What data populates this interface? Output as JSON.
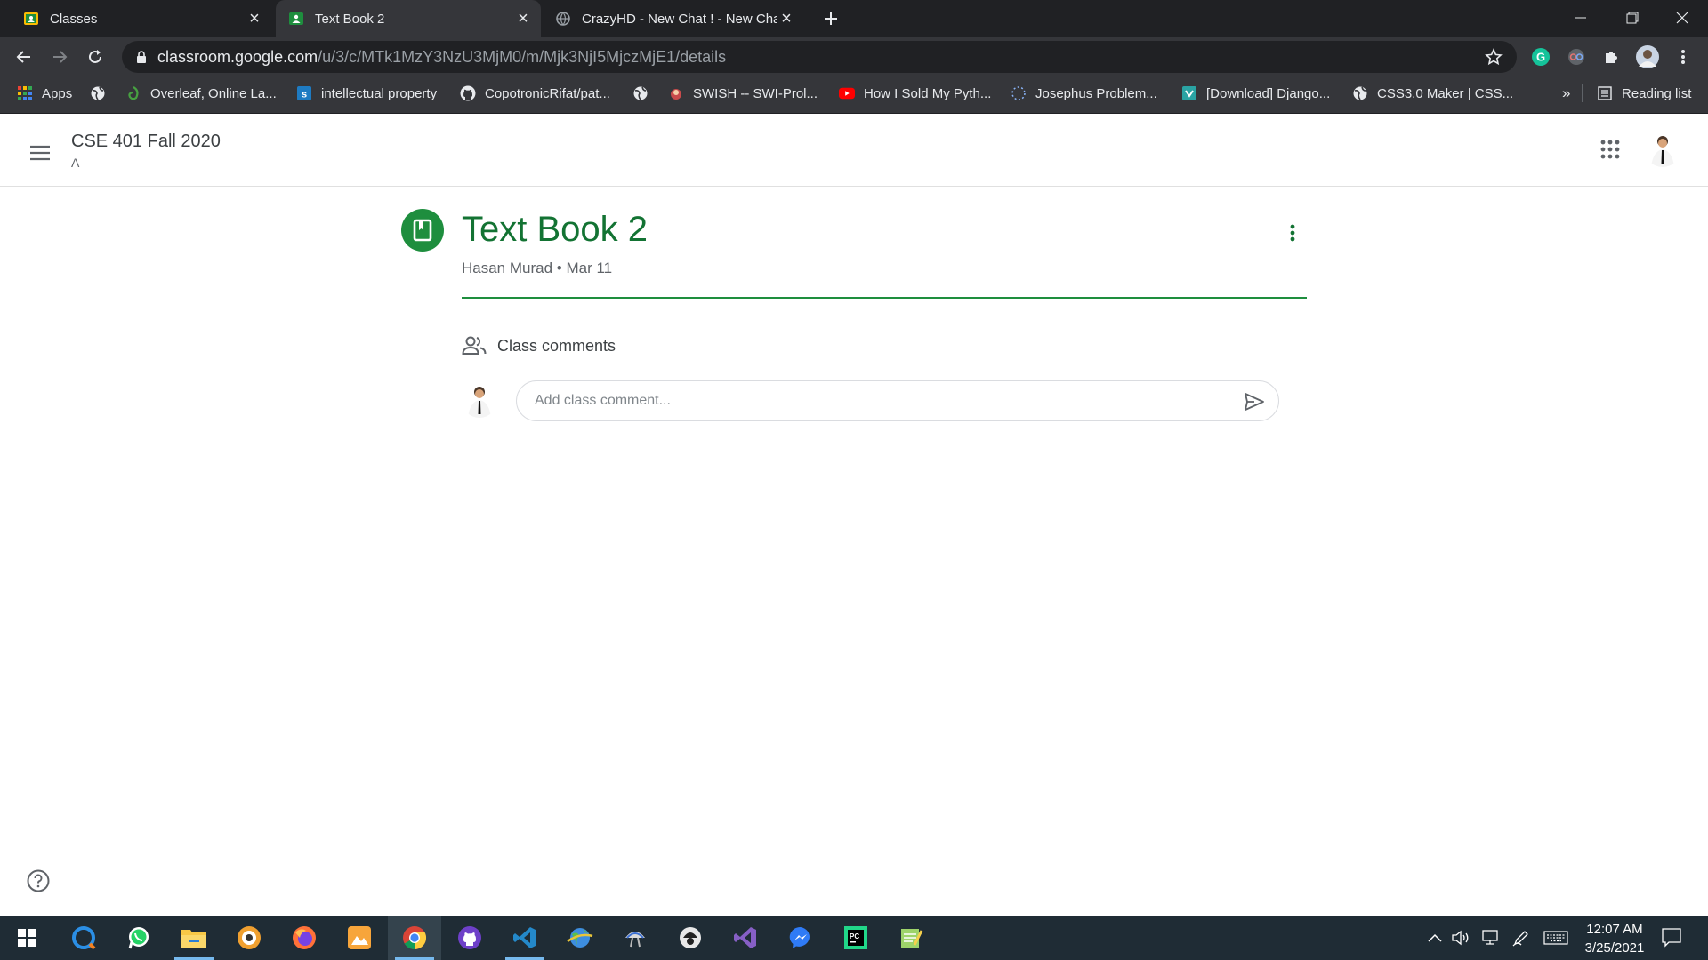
{
  "browser": {
    "tabs": [
      {
        "title": "Classes",
        "icon": "classroom-icon",
        "active": false
      },
      {
        "title": "Text Book 2",
        "icon": "classroom-icon",
        "active": true
      },
      {
        "title": "CrazyHD - New Chat ! - New Cha",
        "icon": "globe-icon",
        "active": false
      }
    ],
    "url_host": "classroom.google.com",
    "url_path": "/u/3/c/MTk1MzY3NzU3MjM0/m/Mjk3NjI5MjczMjE1/details",
    "bookmarks": [
      {
        "label": "Apps",
        "icon": "apps-grid-icon"
      },
      {
        "label": "",
        "icon": "globe-icon"
      },
      {
        "label": "Overleaf, Online La...",
        "icon": "overleaf-icon"
      },
      {
        "label": "intellectual property",
        "icon": "scribd-icon"
      },
      {
        "label": "CopotronicRifat/pat...",
        "icon": "github-icon"
      },
      {
        "label": "",
        "icon": "globe-icon"
      },
      {
        "label": "SWISH -- SWI-Prol...",
        "icon": "swish-icon"
      },
      {
        "label": "How I Sold My Pyth...",
        "icon": "youtube-icon"
      },
      {
        "label": "Josephus Problem...",
        "icon": "loading-icon"
      },
      {
        "label": "[Download] Django...",
        "icon": "site-icon"
      },
      {
        "label": "CSS3.0 Maker | CSS...",
        "icon": "globe-icon"
      }
    ],
    "bookmarks_overflow": "»",
    "reading_list": "Reading list"
  },
  "classroom": {
    "class_name": "CSE 401 Fall 2020",
    "section": "A",
    "post": {
      "title": "Text Book 2",
      "author": "Hasan Murad",
      "date": "Mar 11",
      "separator": "•"
    },
    "comments": {
      "header": "Class comments",
      "placeholder": "Add class comment..."
    }
  },
  "taskbar": {
    "apps": [
      "windows-start-icon",
      "search-app-icon",
      "whatsapp-icon",
      "file-explorer-icon",
      "browser-app-icon",
      "firefox-icon",
      "photo-app-icon",
      "chrome-icon",
      "github-desktop-icon",
      "vscode-icon",
      "globe-app-icon",
      "satellite-app-icon",
      "spy-app-icon",
      "visual-studio-icon",
      "messenger-icon",
      "pycharm-icon",
      "notepad-app-icon"
    ],
    "time": "12:07 AM",
    "date": "3/25/2021"
  },
  "colors": {
    "classroom_green": "#137333",
    "accent_green": "#1e8e3e",
    "chrome_dark": "#202124",
    "chrome_toolbar": "#35363a",
    "taskbar": "#1f2c35"
  }
}
